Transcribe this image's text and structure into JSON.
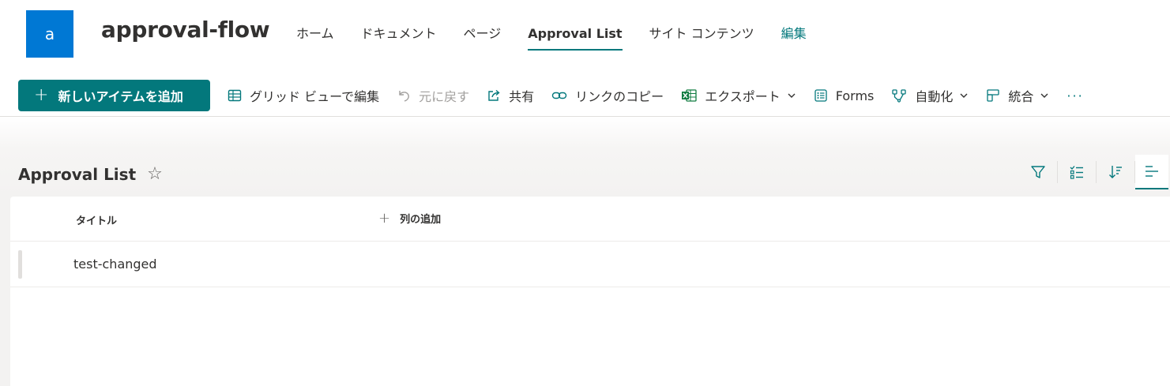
{
  "site": {
    "logo_letter": "a",
    "title": "approval-flow",
    "nav": {
      "home": "ホーム",
      "documents": "ドキュメント",
      "pages": "ページ",
      "approval_list": "Approval List",
      "site_contents": "サイト コンテンツ",
      "edit": "編集"
    },
    "brand_color": "#0078d4",
    "accent_color": "#03787c"
  },
  "command_bar": {
    "new_item": "新しいアイテムを追加",
    "grid_edit": "グリッド ビューで編集",
    "undo": "元に戻す",
    "share": "共有",
    "copy_link": "リンクのコピー",
    "export": "エクスポート",
    "forms": "Forms",
    "automate": "自動化",
    "integrate": "統合",
    "more": "···"
  },
  "list": {
    "title": "Approval List",
    "columns": {
      "title": "タイトル",
      "add_column": "列の追加"
    },
    "rows": [
      {
        "title": "test-changed"
      }
    ]
  }
}
